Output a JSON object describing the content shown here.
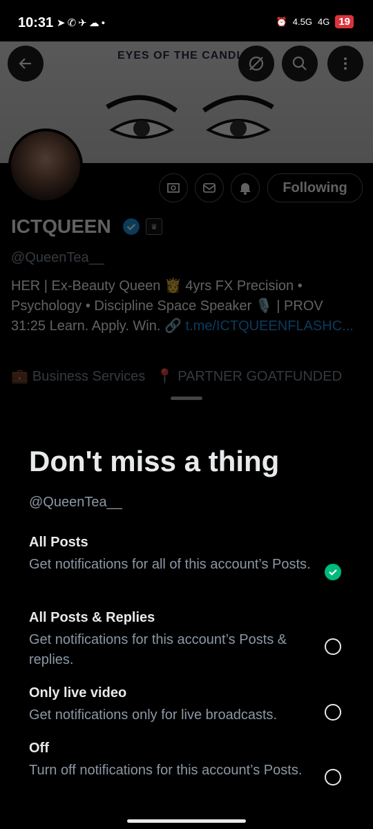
{
  "status": {
    "time": "10:31",
    "network1": "4.5G",
    "network2": "4G",
    "battery": "19"
  },
  "banner": {
    "title": "EYES OF THE CANDLE"
  },
  "profile": {
    "name": "ICTQUEEN",
    "handle": "@QueenTea__",
    "bio_text": "HER | Ex-Beauty Queen 👸  4yrs FX Precision • Psychology • Discipline Space Speaker 🎙️ | PROV 31:25  Learn. Apply. Win. ",
    "bio_link": "t.me/ICTQUEENFLASHC...",
    "category": "Business Services",
    "location": "PARTNER GOATFUNDED",
    "following_label": "Following"
  },
  "sheet": {
    "title": "Don't miss a thing",
    "handle": "@QueenTea__",
    "options": [
      {
        "title": "All Posts",
        "desc": "Get notifications for all of this account’s Posts.",
        "selected": true
      },
      {
        "title": "All Posts & Replies",
        "desc": "Get notifications for this account’s Posts & replies.",
        "selected": false
      },
      {
        "title": "Only live video",
        "desc": "Get notifications only for live broadcasts.",
        "selected": false
      },
      {
        "title": "Off",
        "desc": "Turn off notifications for this account’s Posts.",
        "selected": false
      }
    ]
  },
  "colors": {
    "accent": "#1d9bf0",
    "selected": "#00ba7c",
    "muted": "#8b98a5"
  }
}
